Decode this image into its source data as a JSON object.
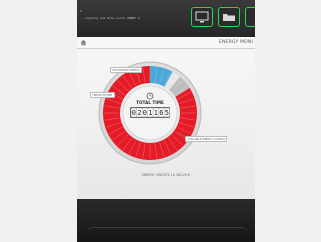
{
  "console": {
    "line1": "$",
    "line2": "...ongoing and mile units ANNEX 6"
  },
  "toolbar": {
    "icons": [
      "display-settings-icon",
      "folder-icon"
    ]
  },
  "screen": {
    "title": "ENERGY MONI",
    "total_label": "TOTAL TIME",
    "odometer": [
      "0",
      "2",
      "0",
      "1",
      "1",
      "6",
      "5"
    ],
    "energy_credit": "ENERGY CREDITS 10,382.29 K"
  },
  "chart_data": {
    "type": "pie",
    "categories": [
      "RECOVERED ENERGY",
      "UNDER POWER",
      "TIME SAVED",
      "AVAILABLE ENERGY"
    ],
    "values": [
      8,
      3,
      5,
      84
    ],
    "colors": [
      "#4aa8d8",
      "#e8e8e8",
      "#bdbdbd",
      "#e51c28"
    ]
  },
  "callouts": {
    "recovered": "RECOVERED ENERGY",
    "under": "UNDER POWER",
    "available": "AVAILABLE ENERGY SAVINGS"
  },
  "colors": {
    "accent_green": "#22d84b",
    "segment_red": "#e51c28",
    "segment_blue": "#4aa8d8"
  }
}
